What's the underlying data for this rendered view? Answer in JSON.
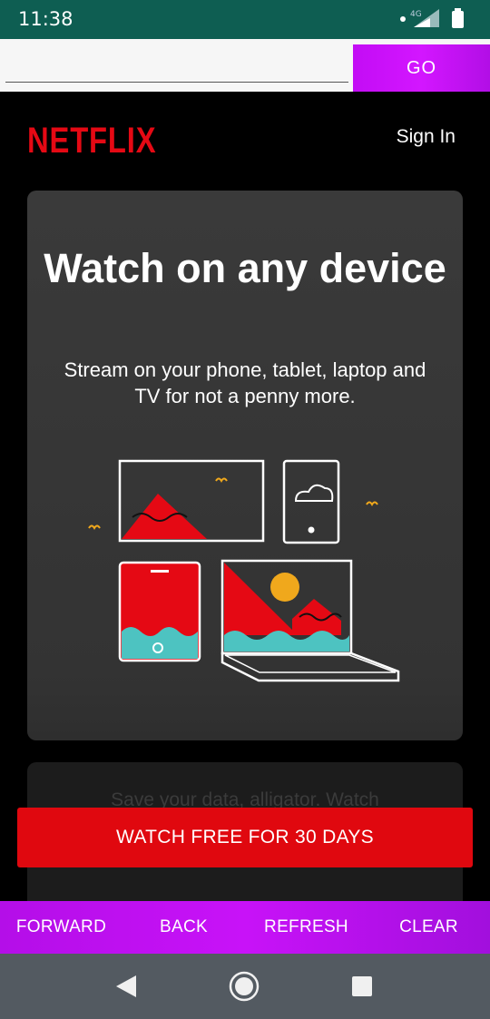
{
  "status": {
    "time": "11:38",
    "network_label": "4G"
  },
  "url_bar": {
    "value": "",
    "go_label": "GO"
  },
  "header": {
    "logo": "NETFLIX",
    "sign_in": "Sign In"
  },
  "card": {
    "title": "Watch on any device",
    "subtitle": "Stream on your phone, tablet, laptop and TV for not a penny more."
  },
  "card2": {
    "text": "Save your data, alligator. Watch"
  },
  "cta": {
    "label": "WATCH FREE FOR 30 DAYS"
  },
  "bottom_nav": {
    "forward": "FORWARD",
    "back": "BACK",
    "refresh": "REFRESH",
    "clear": "CLEAR"
  },
  "colors": {
    "brand_red": "#e50914",
    "accent_purple": "#c812f8",
    "status_bar": "#0e5e52"
  }
}
